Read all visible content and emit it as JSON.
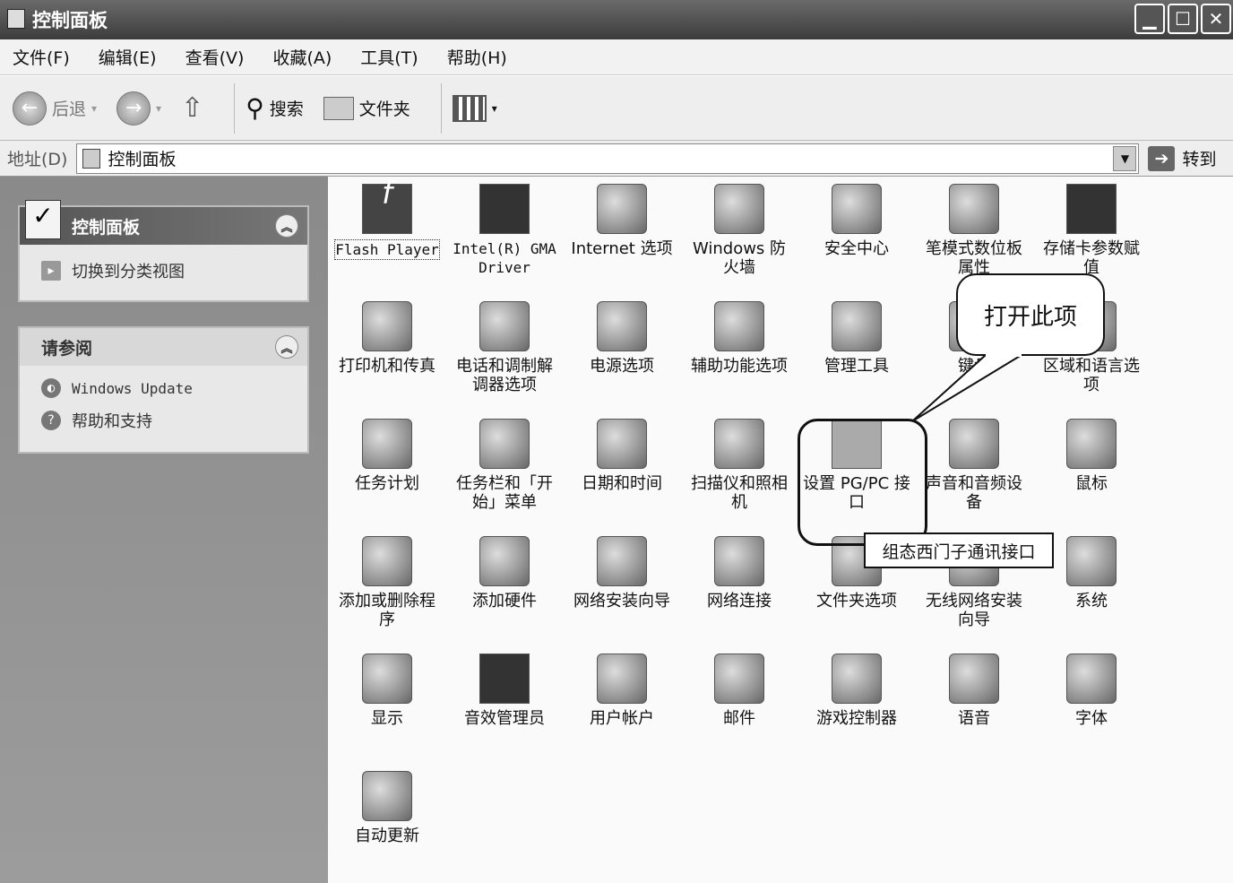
{
  "window": {
    "title": "控制面板",
    "min": "▁",
    "max": "☐",
    "close": "✕"
  },
  "menu": [
    "文件(F)",
    "编辑(E)",
    "查看(V)",
    "收藏(A)",
    "工具(T)",
    "帮助(H)"
  ],
  "toolbar": {
    "back": "后退",
    "search": "搜索",
    "folders": "文件夹"
  },
  "address": {
    "label": "地址(D)",
    "value": "控制面板",
    "go": "转到"
  },
  "sidebar": {
    "panel1": {
      "title": "控制面板",
      "link": "切换到分类视图"
    },
    "panel2": {
      "title": "请参阅",
      "links": [
        "Windows Update",
        "帮助和支持"
      ]
    }
  },
  "items": [
    "Flash Player",
    "Intel(R) GMA Driver",
    "Internet 选项",
    "Windows 防火墙",
    "安全中心",
    "笔模式数位板属性",
    "存储卡参数赋值",
    "打印机和传真",
    "电话和调制解调器选项",
    "电源选项",
    "辅助功能选项",
    "管理工具",
    "键盘",
    "区域和语言选项",
    "任务计划",
    "任务栏和「开始」菜单",
    "日期和时间",
    "扫描仪和照相机",
    "设置 PG/PC 接口",
    "声音和音频设备",
    "鼠标",
    "添加或删除程序",
    "添加硬件",
    "网络安装向导",
    "网络连接",
    "文件夹选项",
    "无线网络安装向导",
    "系统",
    "显示",
    "音效管理员",
    "用户帐户",
    "邮件",
    "游戏控制器",
    "语音",
    "字体",
    "自动更新"
  ],
  "callout": "打开此项",
  "tooltip": "组态西门子通讯接口"
}
